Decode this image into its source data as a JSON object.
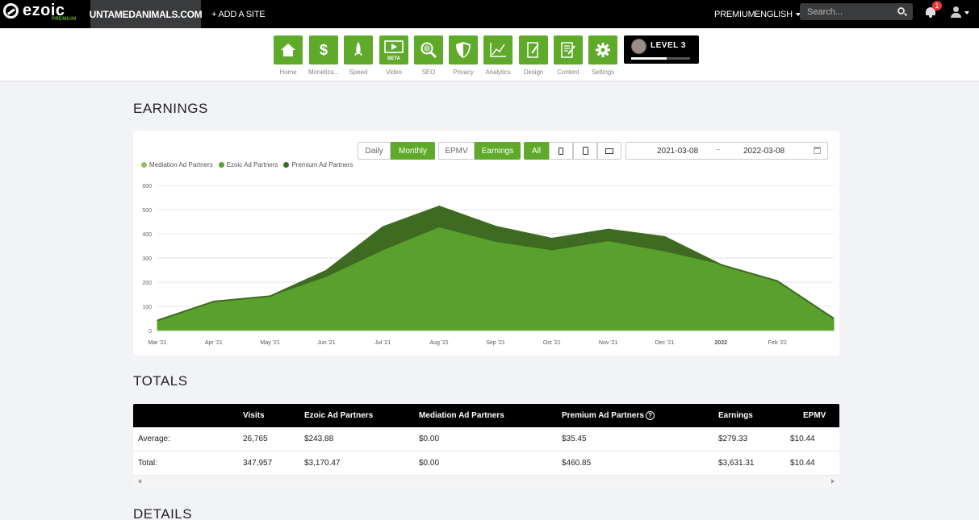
{
  "topbar": {
    "logo": "ezoic",
    "logo_sub": "PREMIUM",
    "site_name": "UNTAMEDANIMALS.COM",
    "add_site": "+ ADD A SITE",
    "premium": "PREMIUM",
    "language": "ENGLISH",
    "search_placeholder": "Search...",
    "notification_count": "1"
  },
  "nav": [
    {
      "label": "Home",
      "icon": "home-icon"
    },
    {
      "label": "Monetiza...",
      "icon": "dollar-icon"
    },
    {
      "label": "Speed",
      "icon": "rocket-icon"
    },
    {
      "label": "Video",
      "icon": "video-icon"
    },
    {
      "label": "SEO",
      "icon": "magnifier-icon"
    },
    {
      "label": "Privacy",
      "icon": "shield-icon"
    },
    {
      "label": "Analytics",
      "icon": "analytics-icon"
    },
    {
      "label": "Design",
      "icon": "design-icon"
    },
    {
      "label": "Content",
      "icon": "content-icon"
    },
    {
      "label": "Settings",
      "icon": "gear-icon"
    }
  ],
  "video_badge": "BETA",
  "level": {
    "label": "LEVEL 3",
    "progress": 0.6
  },
  "earnings": {
    "heading": "EARNINGS",
    "buttons": {
      "daily": "Daily",
      "monthly": "Monthly",
      "epmv": "EPMV",
      "earnings": "Earnings",
      "all": "All"
    },
    "date_start": "2021-03-08",
    "date_sep": "~",
    "date_end": "2022-03-08"
  },
  "chart_data": {
    "type": "area",
    "categories": [
      "Mar '21",
      "Apr '21",
      "May '21",
      "Jun '21",
      "Jul '21",
      "Aug '21",
      "Sep '21",
      "Oct '21",
      "Nov '21",
      "Dec '21",
      "2022",
      "Feb '22",
      "Mar '22"
    ],
    "x_tick_labels": [
      "Mar '21",
      "Apr '21",
      "May '21",
      "Jun '21",
      "Jul '21",
      "Aug '21",
      "Sep '21",
      "Oct '21",
      "Nov '21",
      "Dec '21",
      "2022",
      "Feb '22"
    ],
    "series": [
      {
        "name": "Mediation Ad Partners",
        "color": "#8bc165",
        "values": [
          0,
          0,
          0,
          0,
          0,
          0,
          0,
          0,
          0,
          0,
          0,
          0,
          0
        ]
      },
      {
        "name": "Ezoic Ad Partners",
        "color": "#5aa02c",
        "values": [
          40,
          118,
          140,
          220,
          330,
          425,
          365,
          330,
          368,
          325,
          272,
          205,
          50
        ]
      },
      {
        "name": "Premium Ad Partners",
        "color": "#3e6b21",
        "values": [
          2,
          2,
          2,
          28,
          98,
          88,
          65,
          50,
          50,
          62,
          0,
          0,
          0
        ]
      }
    ],
    "yticks": [
      0,
      100,
      200,
      300,
      400,
      500,
      600
    ],
    "ylim": [
      0,
      600
    ],
    "stacked": true,
    "grid": true,
    "legend": "top-left"
  },
  "totals": {
    "heading": "TOTALS",
    "columns": [
      "",
      "Visits",
      "Ezoic Ad Partners",
      "Mediation Ad Partners",
      "Premium Ad Partners",
      "Earnings",
      "EPMV"
    ],
    "rows": [
      {
        "label": "Average:",
        "visits": "26,765",
        "ezoic": "$243.88",
        "mediation": "$0.00",
        "premium": "$35.45",
        "earnings": "$279.33",
        "epmv": "$10.44"
      },
      {
        "label": "Total:",
        "visits": "347,957",
        "ezoic": "$3,170.47",
        "mediation": "$0.00",
        "premium": "$460.85",
        "earnings": "$3,631.31",
        "epmv": "$10.44"
      }
    ]
  },
  "details": {
    "heading": "DETAILS"
  }
}
